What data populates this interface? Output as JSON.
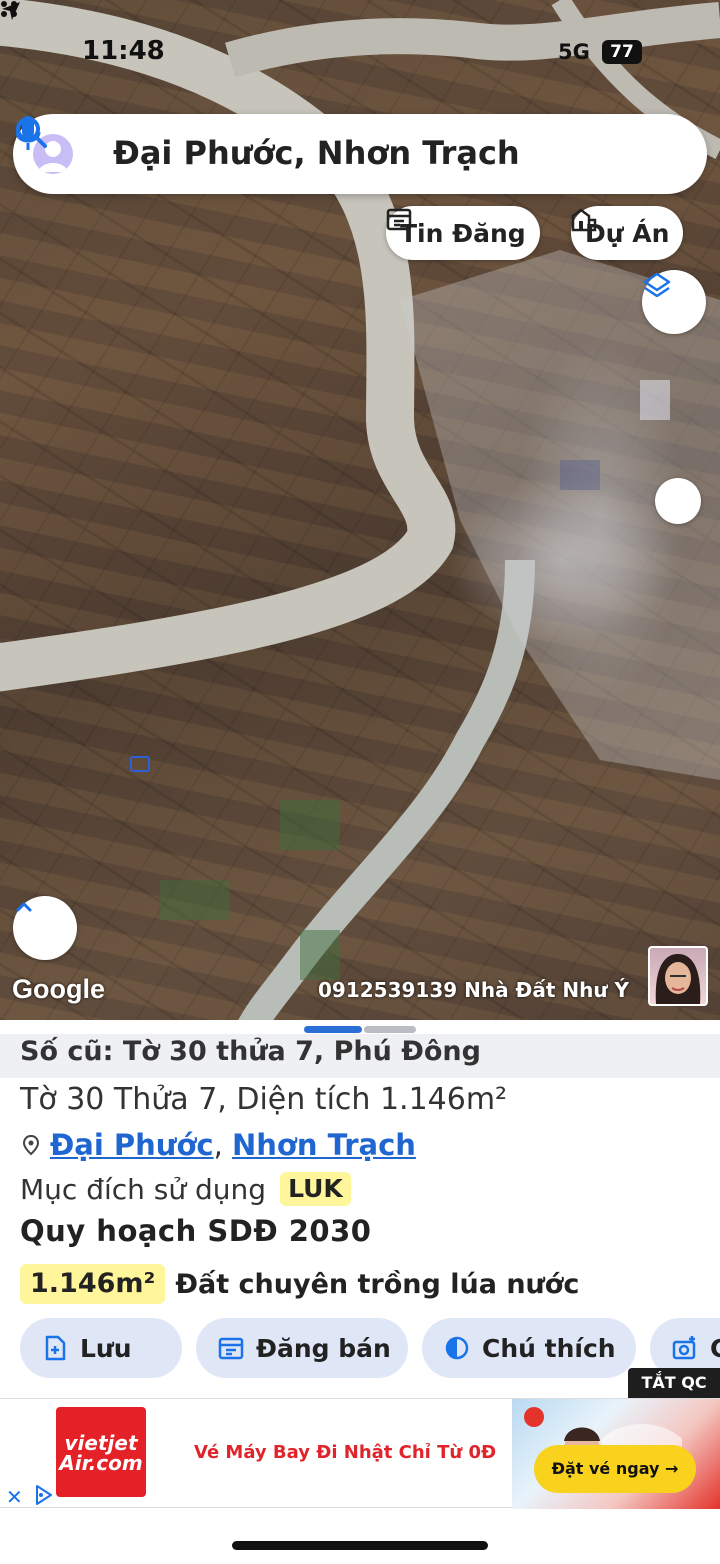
{
  "status_bar": {
    "time": "11:48",
    "network": "5G",
    "battery": "77"
  },
  "search": {
    "query": "Đại Phước, Nhơn Trạch"
  },
  "map": {
    "chips": {
      "listings": "Tin Đăng",
      "projects": "Dự Án"
    },
    "google_label": "Google",
    "watermark": "0912539139 Nhà Đất Như Ý"
  },
  "parcel": {
    "old_id": "Số cũ: Tờ 30 thửa 7, Phú Đông",
    "summary": "Tờ 30 Thửa 7, Diện tích 1.146m²",
    "location": {
      "ward": "Đại Phước",
      "separator": ",",
      "district": "Nhơn Trạch"
    },
    "purpose_label": "Mục đích sử dụng",
    "purpose_code": "LUK",
    "plan_title": "Quy hoạch SDĐ 2030",
    "plan_area": "1.146m²",
    "plan_use": "Đất chuyên trồng lúa nước"
  },
  "actions": {
    "save": "Lưu",
    "post": "Đăng bán",
    "legend": "Chú thích",
    "more": "C"
  },
  "ad": {
    "close_tag": "TẮT QC",
    "brand": "vietjet Air.com",
    "headline": "Vé Máy Bay Đi Nhật Chỉ Từ 0Đ",
    "cta": "Đặt vé ngay →"
  },
  "colors": {
    "link": "#1f66d1",
    "badge": "#fff59a",
    "button_bg": "#dfe7f7",
    "ad_red": "#e0242b"
  }
}
